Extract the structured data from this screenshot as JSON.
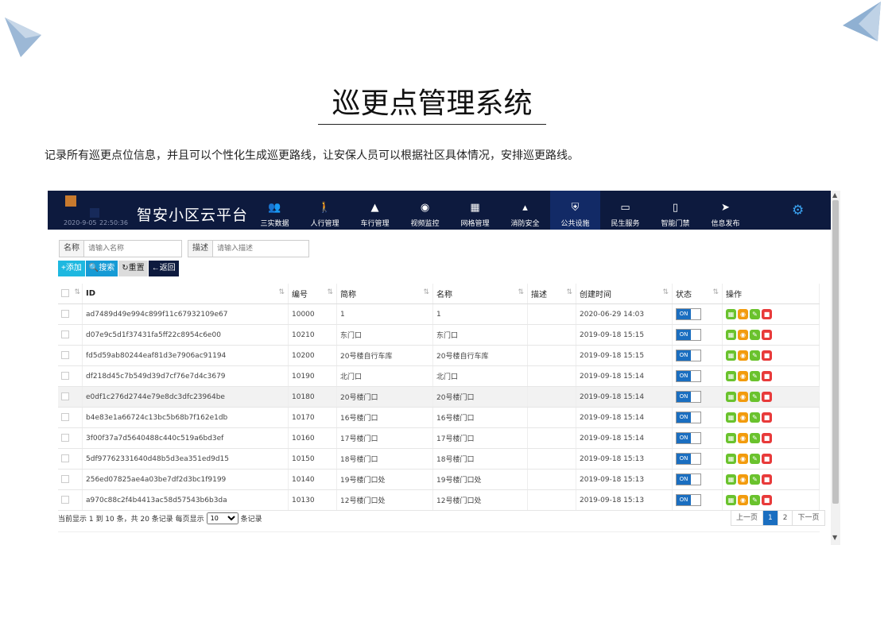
{
  "doc": {
    "title": "巡更点管理系统",
    "description": "记录所有巡更点位信息，并且可以个性化生成巡更路线，让安保人员可以根据社区具体情况，安排巡更路线。"
  },
  "app": {
    "date": "2020-9-05",
    "time": "22:50:36",
    "brand": "智安小区云平台",
    "nav": [
      {
        "label": "三实数据",
        "icon": "people-icon",
        "glyph": "👥"
      },
      {
        "label": "人行管理",
        "icon": "walker-icon",
        "glyph": "🚶"
      },
      {
        "label": "车行管理",
        "icon": "cone-icon",
        "glyph": "▲"
      },
      {
        "label": "视频监控",
        "icon": "camera-icon",
        "glyph": "◉"
      },
      {
        "label": "网格管理",
        "icon": "grid-icon",
        "glyph": "▦"
      },
      {
        "label": "消防安全",
        "icon": "extinguisher-icon",
        "glyph": "▴"
      },
      {
        "label": "公共设施",
        "icon": "shield-icon",
        "glyph": "⛨"
      },
      {
        "label": "民生服务",
        "icon": "service-icon",
        "glyph": "▭"
      },
      {
        "label": "智能门禁",
        "icon": "door-icon",
        "glyph": "▯"
      },
      {
        "label": "信息发布",
        "icon": "send-icon",
        "glyph": "➤"
      }
    ],
    "active_nav": 6,
    "settings_icon": "gear-icon"
  },
  "search": {
    "name_label": "名称",
    "name_placeholder": "请输入名称",
    "desc_label": "描述",
    "desc_placeholder": "请输入描述"
  },
  "toolbar": {
    "add": "+添加",
    "search": "🔍搜索",
    "reset": "↻重置",
    "back": "←返回"
  },
  "table": {
    "headers": [
      "ID",
      "编号",
      "简称",
      "名称",
      "描述",
      "创建时间",
      "状态",
      "操作"
    ],
    "toggle_label": "ON",
    "rows": [
      {
        "id": "ad7489d49e994c899f11c67932109e67",
        "code": "10000",
        "short": "1",
        "name": "1",
        "desc": "",
        "created": "2020-06-29 14:03"
      },
      {
        "id": "d07e9c5d1f37431fa5ff22c8954c6e00",
        "code": "10210",
        "short": "东门口",
        "name": "东门口",
        "desc": "",
        "created": "2019-09-18 15:15"
      },
      {
        "id": "fd5d59ab80244eaf81d3e7906ac91194",
        "code": "10200",
        "short": "20号楼自行车库",
        "name": "20号楼自行车库",
        "desc": "",
        "created": "2019-09-18 15:15"
      },
      {
        "id": "df218d45c7b549d39d7cf76e7d4c3679",
        "code": "10190",
        "short": "北门口",
        "name": "北门口",
        "desc": "",
        "created": "2019-09-18 15:14"
      },
      {
        "id": "e0df1c276d2744e79e8dc3dfc23964be",
        "code": "10180",
        "short": "20号楼门口",
        "name": "20号楼门口",
        "desc": "",
        "created": "2019-09-18 15:14"
      },
      {
        "id": "b4e83e1a66724c13bc5b68b7f162e1db",
        "code": "10170",
        "short": "16号楼门口",
        "name": "16号楼门口",
        "desc": "",
        "created": "2019-09-18 15:14"
      },
      {
        "id": "3f00f37a7d5640488c440c519a6bd3ef",
        "code": "10160",
        "short": "17号楼门口",
        "name": "17号楼门口",
        "desc": "",
        "created": "2019-09-18 15:14"
      },
      {
        "id": "5df97762331640d48b5d3ea351ed9d15",
        "code": "10150",
        "short": "18号楼门口",
        "name": "18号楼门口",
        "desc": "",
        "created": "2019-09-18 15:13"
      },
      {
        "id": "256ed07825ae4a03be7df2d3bc1f9199",
        "code": "10140",
        "short": "19号楼门口处",
        "name": "19号楼门口处",
        "desc": "",
        "created": "2019-09-18 15:13"
      },
      {
        "id": "a970c88c2f4b4413ac58d57543b6b3da",
        "code": "10130",
        "short": "12号楼门口处",
        "name": "12号楼门口处",
        "desc": "",
        "created": "2019-09-18 15:13"
      }
    ],
    "highlighted_row": 4
  },
  "footer": {
    "info_prefix": "当前显示 1 到 10 条，共 20 条记录  每页显示",
    "page_size": "10",
    "info_suffix": "条记录",
    "pager": [
      "上一页",
      "1",
      "2",
      "下一页"
    ],
    "current_page": "1"
  }
}
